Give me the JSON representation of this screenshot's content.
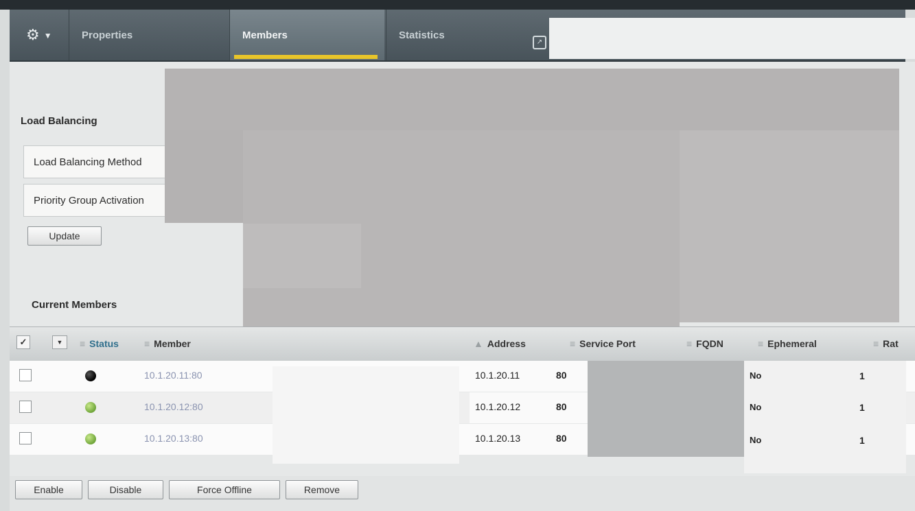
{
  "tabs": {
    "menu_icon": "gear-icon",
    "properties": "Properties",
    "members": "Members",
    "statistics": "Statistics"
  },
  "load_balancing": {
    "title": "Load Balancing",
    "method_label": "Load Balancing Method",
    "priority_label": "Priority Group Activation",
    "update_button": "Update"
  },
  "current_members": {
    "title": "Current Members",
    "columns": {
      "status": "Status",
      "member": "Member",
      "address": "Address",
      "service_port": "Service Port",
      "fqdn": "FQDN",
      "ephemeral": "Ephemeral",
      "ratio": "Rat"
    },
    "rows": [
      {
        "status": "offline",
        "member": "10.1.20.11:80",
        "address": "10.1.20.11",
        "port": "80",
        "ephemeral": "No",
        "ratio": "1"
      },
      {
        "status": "online",
        "member": "10.1.20.12:80",
        "address": "10.1.20.12",
        "port": "80",
        "ephemeral": "No",
        "ratio": "1"
      },
      {
        "status": "online",
        "member": "10.1.20.13:80",
        "address": "10.1.20.13",
        "port": "80",
        "ephemeral": "No",
        "ratio": "1"
      }
    ],
    "buttons": {
      "enable": "Enable",
      "disable": "Disable",
      "force_offline": "Force Offline",
      "remove": "Remove"
    }
  },
  "colors": {
    "tab_accent": "#e8c52a",
    "status_online": "#6fa53a",
    "status_offline": "#000000"
  }
}
